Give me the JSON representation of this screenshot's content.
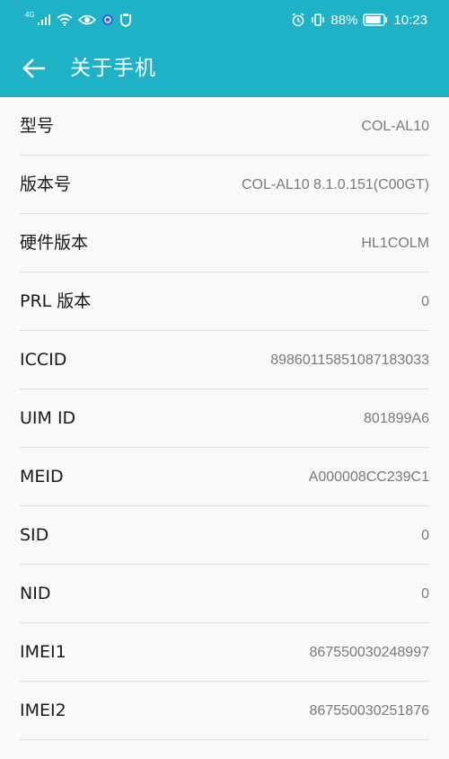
{
  "status_bar": {
    "network_label": "4G",
    "battery_percent": "88%",
    "time": "10:23",
    "battery_level": 0.88
  },
  "header": {
    "title": "关于手机"
  },
  "info_rows": [
    {
      "label": "型号",
      "value": "COL-AL10"
    },
    {
      "label": "版本号",
      "value": "COL-AL10 8.1.0.151(C00GT)"
    },
    {
      "label": "硬件版本",
      "value": "HL1COLM"
    },
    {
      "label": "PRL 版本",
      "value": "0"
    },
    {
      "label": "ICCID",
      "value": "89860115851087183033"
    },
    {
      "label": "UIM ID",
      "value": "801899A6"
    },
    {
      "label": "MEID",
      "value": "A000008CC239C1"
    },
    {
      "label": "SID",
      "value": "0"
    },
    {
      "label": "NID",
      "value": "0"
    },
    {
      "label": "IMEI1",
      "value": "867550030248997"
    },
    {
      "label": "IMEI2",
      "value": "867550030251876"
    }
  ],
  "colors": {
    "accent": "#1fb1c6",
    "background": "#f9f8fb",
    "label_text": "#1a1a1a",
    "value_text": "#7a7a7a"
  }
}
